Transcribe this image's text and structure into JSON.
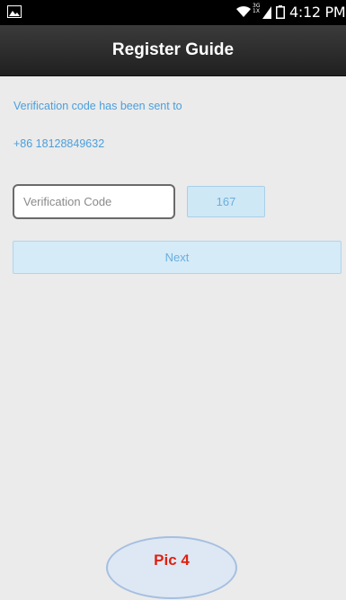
{
  "status_bar": {
    "network_label": "3G",
    "network_label2": "1X",
    "time": "4:12 PM",
    "icons": [
      "gallery-icon",
      "wifi-icon",
      "signal-icon",
      "battery-icon"
    ]
  },
  "header": {
    "title": "Register Guide"
  },
  "main": {
    "info_text": "Verification code has been sent to",
    "phone_number": "+86 18128849632",
    "code_input": {
      "value": "",
      "placeholder": "Verification Code"
    },
    "resend_countdown": "167",
    "next_label": "Next"
  },
  "overlay": {
    "badge_label": "Pic 4"
  },
  "colors": {
    "accent": "#4a9fdc",
    "button_fill": "#d5ebf8",
    "badge_text": "#e02010"
  }
}
